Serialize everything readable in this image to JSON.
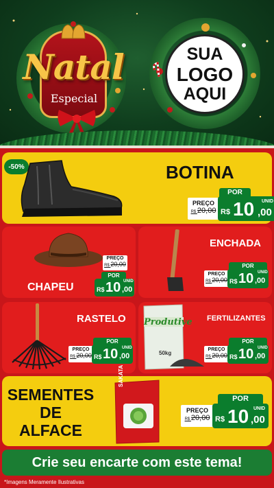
{
  "header": {
    "natal": "Natal",
    "especial": "Especial",
    "logo_lines": [
      "SUA",
      "LOGO",
      "AQUI"
    ]
  },
  "products": {
    "botina": {
      "name": "BOTINA",
      "badge": "-50%",
      "preco_label": "PREÇO",
      "old_price": "20,00",
      "old_prefix": "R$",
      "por": "POR",
      "rs": "R$",
      "price_int": "10",
      "price_cents": ",00",
      "unid": "UNID"
    },
    "chapeu": {
      "name": "CHAPEU",
      "preco_label": "PREÇO",
      "old_price": "20,00",
      "old_prefix": "R$",
      "por": "POR",
      "rs": "R$",
      "price_int": "10",
      "price_cents": ",00",
      "unid": "UNID"
    },
    "enchada": {
      "name": "ENCHADA",
      "preco_label": "PREÇO",
      "old_price": "20,00",
      "old_prefix": "R$",
      "por": "POR",
      "rs": "R$",
      "price_int": "10",
      "price_cents": ",00",
      "unid": "UNID"
    },
    "rastelo": {
      "name": "RASTELO",
      "preco_label": "PREÇO",
      "old_price": "20,00",
      "old_prefix": "R$",
      "por": "POR",
      "rs": "R$",
      "price_int": "10",
      "price_cents": ",00",
      "unid": "UNID"
    },
    "fertilizantes": {
      "name": "FERTILIZANTES",
      "bag_brand": "Produtive",
      "bag_weight": "50kg",
      "preco_label": "PREÇO",
      "old_price": "20,00",
      "old_prefix": "R$",
      "por": "POR",
      "rs": "R$",
      "price_int": "10",
      "price_cents": ",00",
      "unid": "UNID"
    },
    "sementes": {
      "name_lines": [
        "SEMENTES",
        "DE",
        "ALFACE"
      ],
      "pack_brand": "SAKATA",
      "preco_label": "PREÇO",
      "old_price": "20,00",
      "old_prefix": "R$",
      "por": "POR",
      "rs": "R$",
      "price_int": "10",
      "price_cents": ",00",
      "unid": "UNID"
    }
  },
  "footer": {
    "cta": "Crie seu encarte com este tema!",
    "disclaimer": "*Imagens Meramente Ilustrativas"
  },
  "colors": {
    "red": "#e11d1d",
    "yellow": "#f4cd0f",
    "green": "#0b7d2d",
    "gold": "#f7c548"
  }
}
